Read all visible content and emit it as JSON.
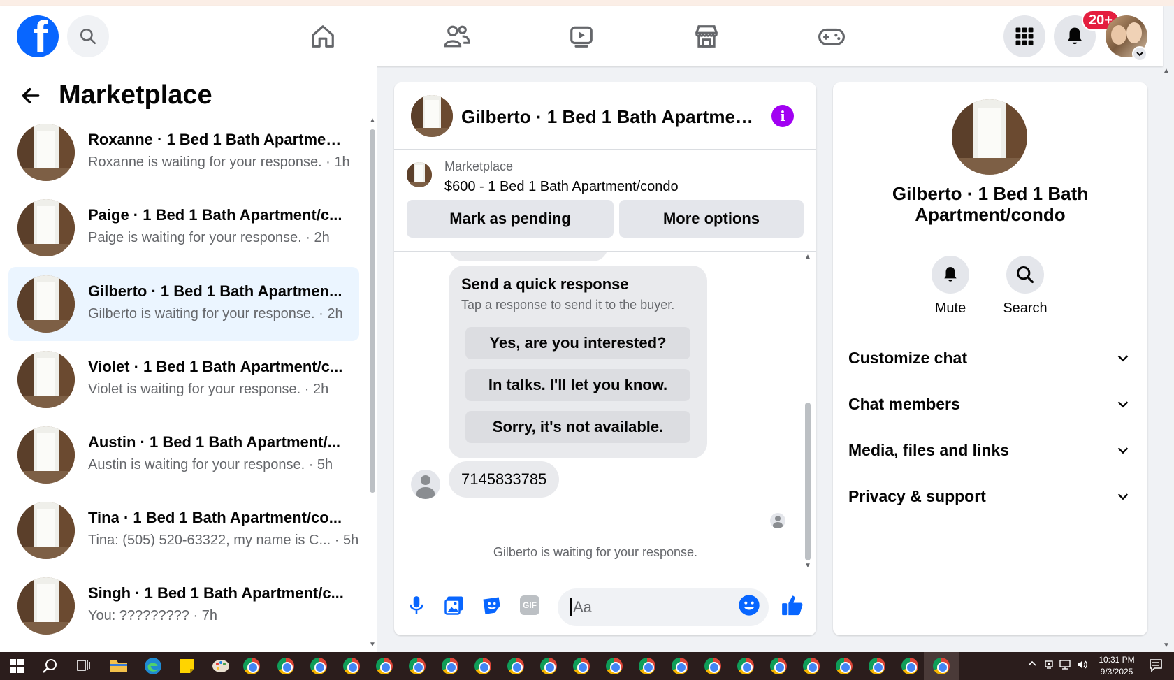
{
  "header": {
    "logo": "f",
    "badge": "20+"
  },
  "sidebar": {
    "title": "Marketplace",
    "conversations": [
      {
        "name": "Roxanne · 1 Bed 1 Bath Apartmen...",
        "sub": "Roxanne is waiting for your response. · 1h"
      },
      {
        "name": "Paige · 1 Bed 1 Bath Apartment/c...",
        "sub": "Paige is waiting for your response. · 2h"
      },
      {
        "name": "Gilberto · 1 Bed 1 Bath Apartmen...",
        "sub": "Gilberto is waiting for your response. · 2h"
      },
      {
        "name": "Violet · 1 Bed 1 Bath Apartment/c...",
        "sub": "Violet is waiting for your response. · 2h"
      },
      {
        "name": "Austin · 1 Bed 1 Bath Apartment/...",
        "sub": "Austin is waiting for your response. · 5h"
      },
      {
        "name": "Tina · 1 Bed 1 Bath Apartment/co...",
        "sub": "Tina: (505) 520-63322, my name is C... · 5h"
      },
      {
        "name": "Singh · 1 Bed 1 Bath Apartment/c...",
        "sub": "You: ????????? · 7h"
      }
    ]
  },
  "chat": {
    "title": "Gilberto · 1 Bed 1 Bath Apartment/...",
    "info_icon": "i",
    "listing_source": "Marketplace",
    "listing_title": "$600 - 1 Bed 1 Bath Apartment/condo",
    "mark_pending_label": "Mark as pending",
    "more_options_label": "More options",
    "quick_response_title": "Send a quick response",
    "quick_response_sub": "Tap a response to send it to the buyer.",
    "quick_options": [
      "Yes, are you interested?",
      "In talks. I'll let you know.",
      "Sorry, it's not available."
    ],
    "message": "7145833785",
    "waiting": "Gilberto is waiting for your response.",
    "input_placeholder": "Aa",
    "gif_label": "GIF"
  },
  "details": {
    "title_line1": "Gilberto · 1 Bed 1 Bath",
    "title_line2": "Apartment/condo",
    "mute_label": "Mute",
    "search_label": "Search",
    "sections": [
      "Customize chat",
      "Chat members",
      "Media, files and links",
      "Privacy & support"
    ]
  },
  "taskbar": {
    "time": "10:31 PM",
    "date": "9/3/2025"
  },
  "colors": {
    "brand": "#0866ff",
    "info": "#a100f2",
    "badge": "#e41e3f",
    "active_conv": "#ebf5ff"
  }
}
